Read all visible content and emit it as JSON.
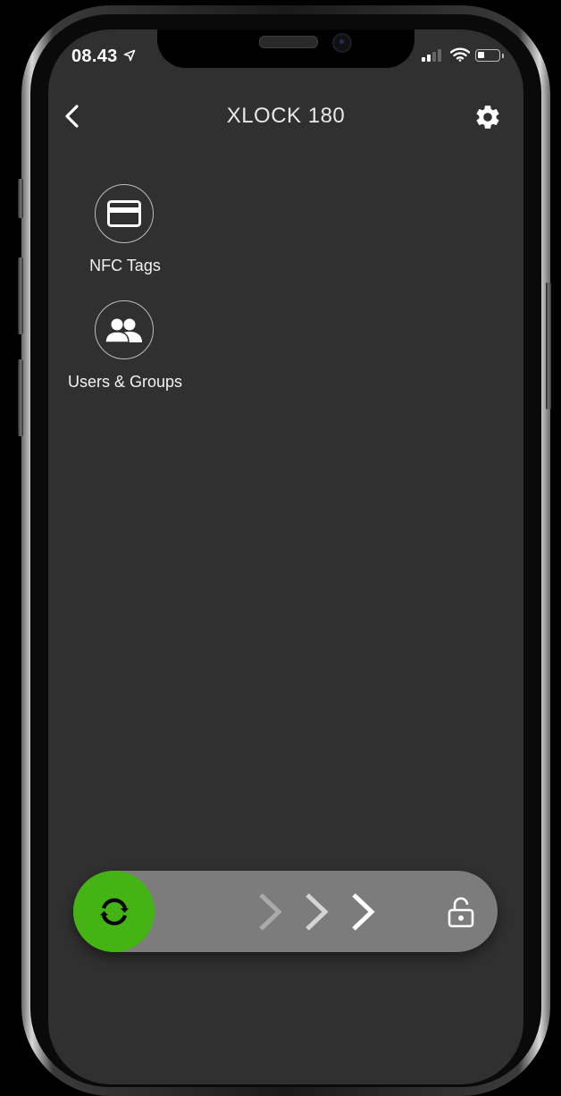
{
  "status_bar": {
    "time": "08.43",
    "location_icon": "location-arrow-icon",
    "signal_icon": "cellular-signal-icon",
    "wifi_icon": "wifi-icon",
    "battery_icon": "battery-icon",
    "battery_level": 0.35
  },
  "header": {
    "back_icon": "chevron-left-icon",
    "title": "XLOCK 180",
    "settings_icon": "gear-icon"
  },
  "menu": {
    "items": [
      {
        "label": "NFC Tags",
        "icon": "credit-card-icon"
      },
      {
        "label": "Users & Groups",
        "icon": "users-icon"
      }
    ]
  },
  "unlock_slider": {
    "knob_icon": "sync-arrows-icon",
    "progress_icons": [
      "chevron-right-icon",
      "chevron-right-icon",
      "chevron-right-icon"
    ],
    "end_icon": "unlocked-padlock-icon",
    "progress": 0,
    "colors": {
      "knob": "#43b414",
      "track": "#7c7c7c"
    }
  },
  "colors": {
    "background": "#303030",
    "text": "#ffffff",
    "accent": "#43b414"
  }
}
